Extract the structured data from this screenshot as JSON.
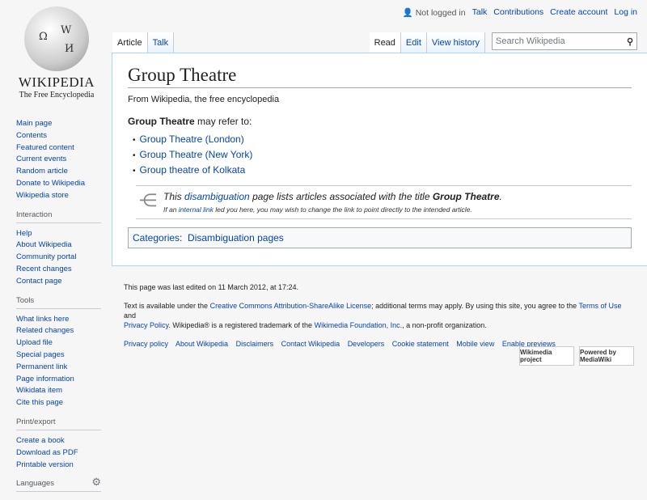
{
  "logo": {
    "wordmark": "Wikipedia",
    "tagline": "The Free Encyclopedia"
  },
  "personal": {
    "status": "Not logged in",
    "links": [
      "Talk",
      "Contributions",
      "Create account",
      "Log in"
    ]
  },
  "tabs": {
    "left": [
      "Article",
      "Talk"
    ],
    "right": [
      "Read",
      "Edit",
      "View history"
    ]
  },
  "search": {
    "placeholder": "Search Wikipedia"
  },
  "article": {
    "title": "Group Theatre",
    "subtitle": "From Wikipedia, the free encyclopedia",
    "lead_bold": "Group Theatre",
    "lead_rest": " may refer to:",
    "items": [
      "Group Theatre (London)",
      "Group Theatre (New York)",
      "Group theatre of Kolkata"
    ],
    "dab": {
      "t1": "This ",
      "link1": "disambiguation",
      "t2": " page lists articles associated with the title ",
      "bold": "Group Theatre",
      "t3": ".",
      "s1": "If an ",
      "link2": "internal link",
      "s2": " led you here, you may wish to change the link to point directly to the intended article."
    },
    "categories_label": "Categories",
    "category": "Disambiguation pages"
  },
  "sidebar": {
    "nav": [
      "Main page",
      "Contents",
      "Featured content",
      "Current events",
      "Random article",
      "Donate to Wikipedia",
      "Wikipedia store"
    ],
    "interaction": {
      "title": "Interaction",
      "items": [
        "Help",
        "About Wikipedia",
        "Community portal",
        "Recent changes",
        "Contact page"
      ]
    },
    "tools": {
      "title": "Tools",
      "items": [
        "What links here",
        "Related changes",
        "Upload file",
        "Special pages",
        "Permanent link",
        "Page information",
        "Wikidata item",
        "Cite this page"
      ]
    },
    "print": {
      "title": "Print/export",
      "items": [
        "Create a book",
        "Download as PDF",
        "Printable version"
      ]
    },
    "languages": {
      "title": "Languages"
    }
  },
  "footer": {
    "edited": "This page was last edited on 11 March 2012, at 17:24.",
    "lic1": "Text is available under the ",
    "lic_link": "Creative Commons Attribution-ShareAlike License",
    "lic2": "; additional terms may apply. By using this site, you agree to the ",
    "tou": "Terms of Use",
    "and": " and ",
    "pp": "Privacy Policy",
    "lic3": ". Wikipedia® is a registered trademark of the ",
    "wmf": "Wikimedia Foundation, Inc.",
    "lic4": ", a non-profit organization.",
    "links": [
      "Privacy policy",
      "About Wikipedia",
      "Disclaimers",
      "Contact Wikipedia",
      "Developers",
      "Cookie statement",
      "Mobile view",
      "Enable previews"
    ],
    "badges": [
      "Wikimedia project",
      "Powered by MediaWiki"
    ]
  }
}
